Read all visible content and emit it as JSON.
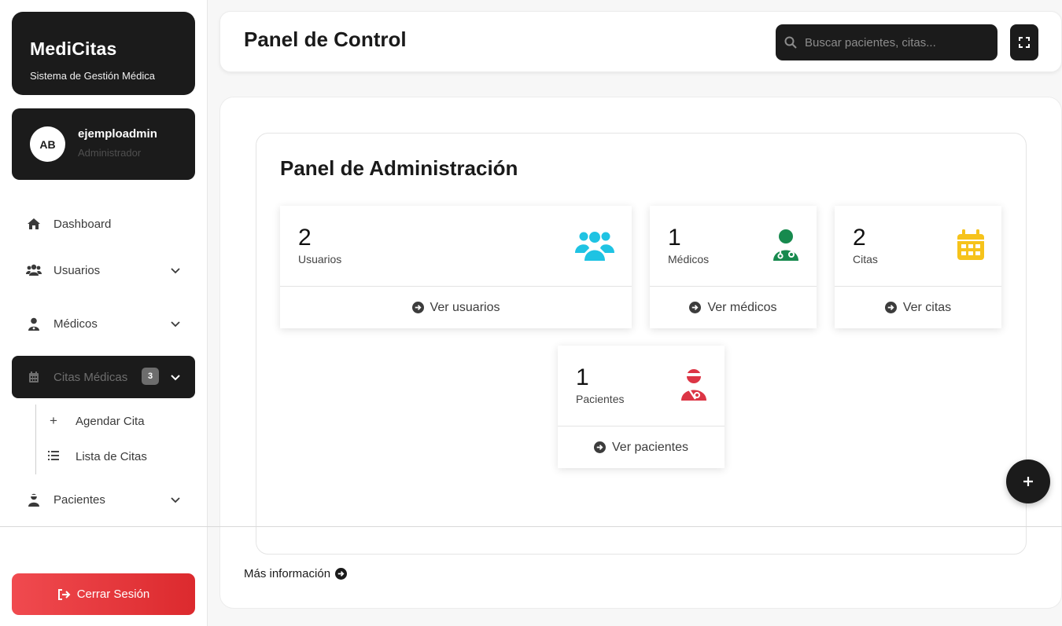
{
  "brand": {
    "title": "MediCitas",
    "subtitle": "Sistema de Gestión Médica"
  },
  "user": {
    "initials": "AB",
    "name": "ejemploadmin",
    "role": "Administrador"
  },
  "sidebar": {
    "items": [
      {
        "label": "Dashboard",
        "icon": "home-icon"
      },
      {
        "label": "Usuarios",
        "icon": "users-icon"
      },
      {
        "label": "Médicos",
        "icon": "doctor-icon"
      },
      {
        "label": "Citas Médicas",
        "icon": "calendar-icon",
        "badge": "3"
      },
      {
        "label": "Pacientes",
        "icon": "patient-icon"
      }
    ],
    "submenu": [
      {
        "label": "Agendar Cita",
        "icon": "plus-icon"
      },
      {
        "label": "Lista de Citas",
        "icon": "list-icon"
      }
    ],
    "logout_label": "Cerrar Sesión"
  },
  "header": {
    "title": "Panel de Control",
    "search_placeholder": "Buscar pacientes, citas..."
  },
  "main": {
    "title": "Panel de Administración",
    "cards": [
      {
        "value": "2",
        "label": "Usuarios",
        "link": "Ver usuarios",
        "icon": "users-icon",
        "color": "#1fc3e3"
      },
      {
        "value": "1",
        "label": "Médicos",
        "link": "Ver médicos",
        "icon": "doctor-icon",
        "color": "#178a4e"
      },
      {
        "value": "2",
        "label": "Citas",
        "link": "Ver citas",
        "icon": "calendar-icon",
        "color": "#f6c31b"
      },
      {
        "value": "1",
        "label": "Pacientes",
        "link": "Ver pacientes",
        "icon": "patient-icon",
        "color": "#dc3545"
      }
    ],
    "more_label": "Más información"
  },
  "colors": {
    "dark": "#1b1b1b",
    "danger": "#e03237"
  }
}
